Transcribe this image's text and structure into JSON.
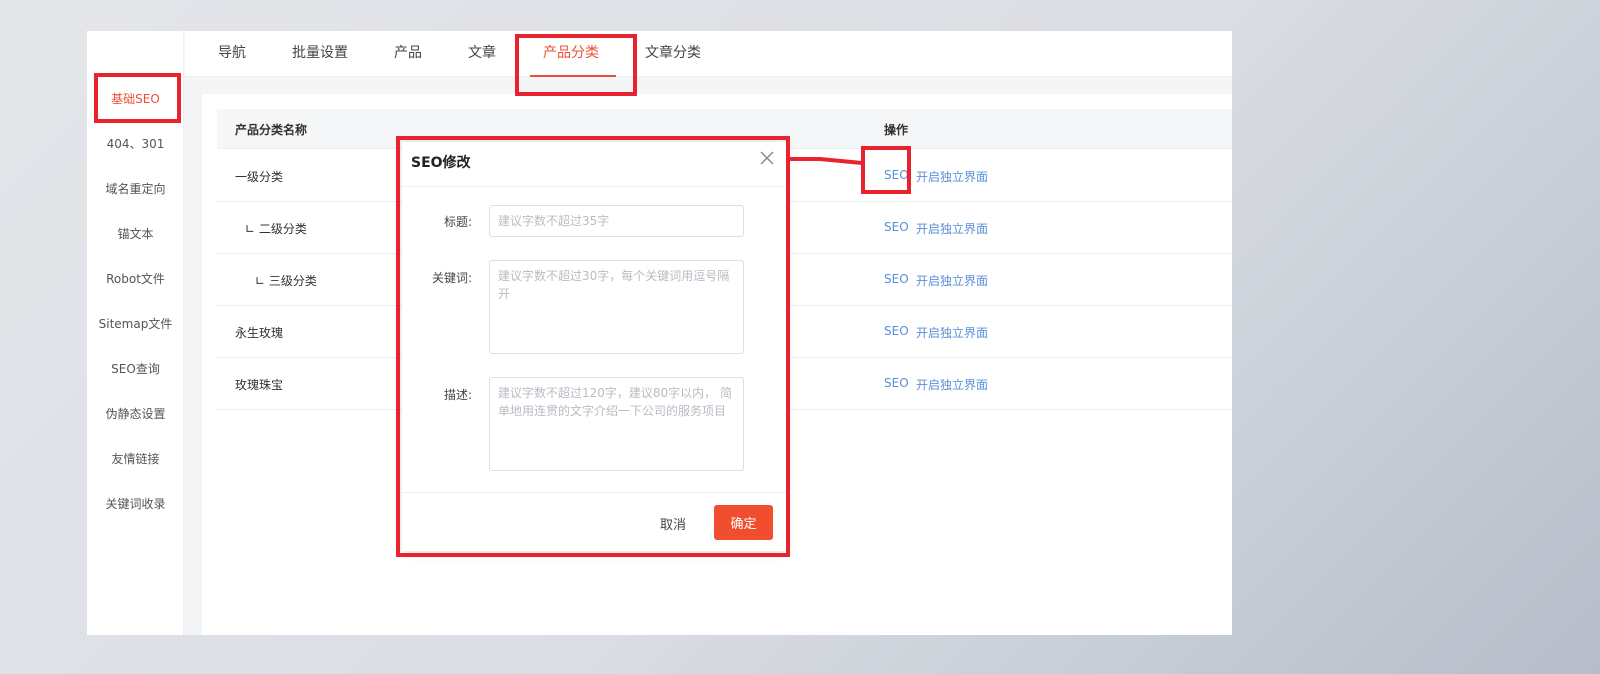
{
  "sidebar": {
    "items": [
      {
        "label": "基础SEO",
        "active": true
      },
      {
        "label": "404、301"
      },
      {
        "label": "域名重定向"
      },
      {
        "label": "锚文本"
      },
      {
        "label": "Robot文件"
      },
      {
        "label": "Sitemap文件"
      },
      {
        "label": "SEO查询"
      },
      {
        "label": "伪静态设置"
      },
      {
        "label": "友情链接"
      },
      {
        "label": "关键词收录"
      }
    ]
  },
  "tabs": [
    {
      "label": "导航"
    },
    {
      "label": "批量设置"
    },
    {
      "label": "产品"
    },
    {
      "label": "文章"
    },
    {
      "label": "产品分类",
      "active": true
    },
    {
      "label": "文章分类"
    }
  ],
  "table": {
    "headers": {
      "name": "产品分类名称",
      "action": "操作"
    },
    "rows": [
      {
        "name": "一级分类",
        "seo": "SEO",
        "page": "开启独立界面"
      },
      {
        "name": "∟ 二级分类",
        "seo": "SEO",
        "page": "开启独立界面"
      },
      {
        "name": "∟ 三级分类",
        "seo": "SEO",
        "page": "开启独立界面"
      },
      {
        "name": "永生玫瑰",
        "seo": "SEO",
        "page": "开启独立界面"
      },
      {
        "name": "玫瑰珠宝",
        "seo": "SEO",
        "page": "开启独立界面"
      }
    ]
  },
  "modal": {
    "title": "SEO修改",
    "title_label": "标题:",
    "title_placeholder": "建议字数不超过35字",
    "keywords_label": "关键词:",
    "keywords_placeholder": "建议字数不超过30字，每个关键词用逗号隔开",
    "desc_label": "描述:",
    "desc_placeholder": "建议字数不超过120字，建议80字以内， 简单地用连贯的文字介绍一下公司的服务项目",
    "cancel": "取消",
    "confirm": "确定"
  },
  "colors": {
    "accent": "#ec4f33",
    "link": "#5a8fd8",
    "highlight": "#e8232e",
    "confirm_button": "#f04e2f"
  }
}
